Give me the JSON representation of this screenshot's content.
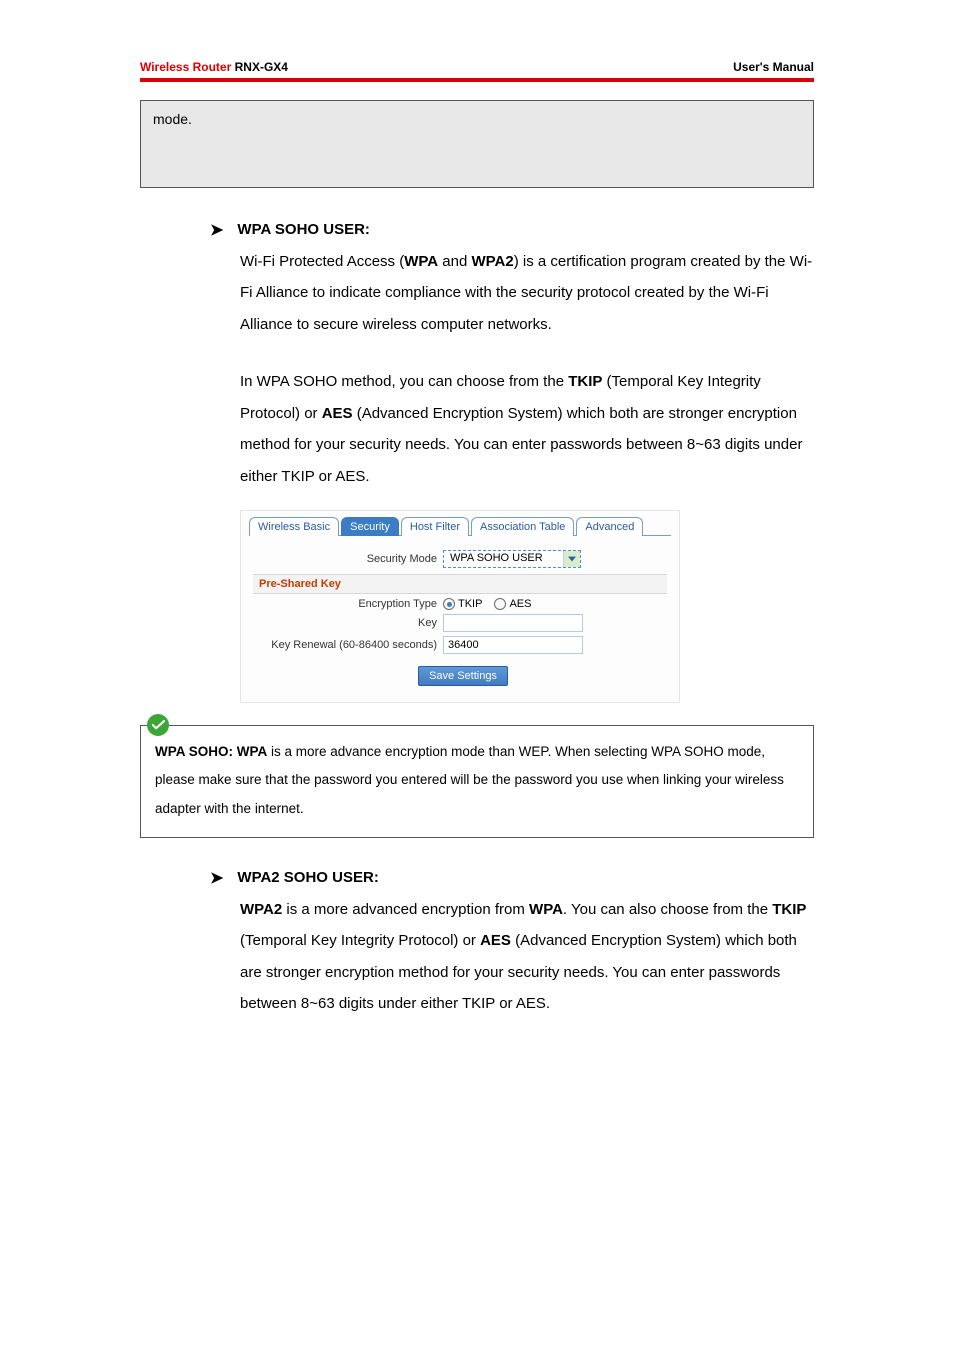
{
  "header": {
    "brand": "Wireless Router",
    "model": "RNX-GX4",
    "right": "User's Manual"
  },
  "graybox": {
    "text": "mode."
  },
  "wpa_soho": {
    "heading": "WPA SOHO USER:",
    "p1_a": "Wi-Fi Protected Access (",
    "p1_b1": "WPA",
    "p1_c": " and ",
    "p1_b2": "WPA2",
    "p1_d": ") is a certification program created by the Wi-Fi Alliance to indicate compliance with the security protocol created by the Wi-Fi Alliance to secure wireless computer networks.",
    "p2_a": "In WPA SOHO method, you can choose from the ",
    "p2_b1": "TKIP",
    "p2_c": " (Temporal Key Integrity Protocol) or ",
    "p2_b2": "AES",
    "p2_d": " (Advanced Encryption System) which both are stronger encryption method for your security needs. You can enter passwords between 8~63 digits under either TKIP or AES."
  },
  "ui": {
    "tabs": {
      "wireless_basic": "Wireless Basic",
      "security": "Security",
      "host_filter": "Host Filter",
      "association_table": "Association Table",
      "advanced": "Advanced"
    },
    "labels": {
      "security_mode": "Security Mode",
      "pre_shared_key": "Pre-Shared Key",
      "encryption_type": "Encryption Type",
      "key": "Key",
      "key_renewal": "Key Renewal (60-86400 seconds)"
    },
    "values": {
      "security_mode": "WPA SOHO USER",
      "tkip": "TKIP",
      "aes": "AES",
      "key": "",
      "key_renewal": "36400",
      "save": "Save Settings"
    }
  },
  "note": {
    "b1": "WPA SOHO: WPA",
    "rest": " is a more advance encryption mode than WEP. When selecting WPA SOHO mode, please make sure that the password you entered will be the password you use when linking your wireless adapter with the internet."
  },
  "wpa2_soho": {
    "heading": "WPA2 SOHO USER:",
    "b1": "WPA2",
    "a": " is a more advanced encryption from ",
    "b2": "WPA",
    "c": ". You can also choose from the ",
    "b3": "TKIP",
    "d": " (Temporal Key Integrity Protocol) or ",
    "b4": "AES",
    "e": " (Advanced Encryption System) which both are stronger encryption method for your security needs. You can enter passwords between 8~63 digits under either TKIP or AES."
  }
}
